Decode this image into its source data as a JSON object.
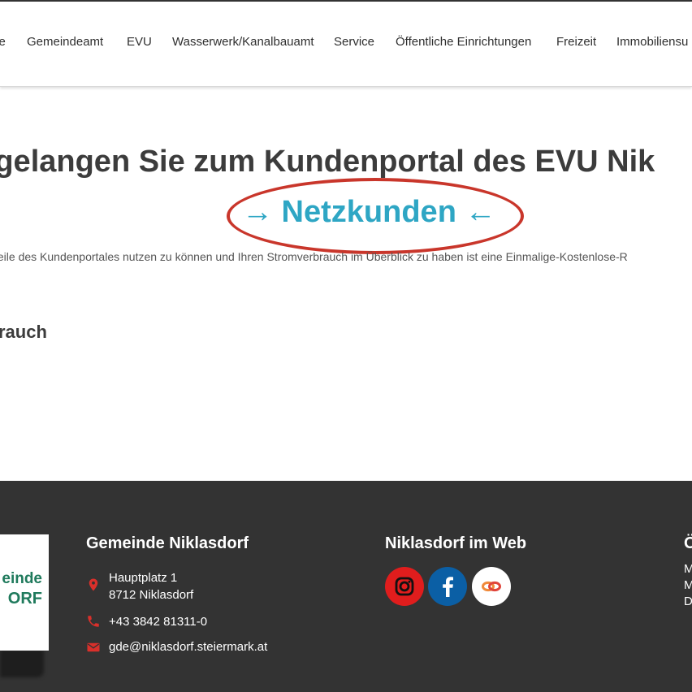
{
  "nav": {
    "items": [
      "me",
      "Gemeindeamt",
      "EVU",
      "Wasserwerk/Kanalbauamt",
      "Service",
      "Öffentliche Einrichtungen",
      "Freizeit",
      "Immobiliensu"
    ]
  },
  "main": {
    "headline": "r gelangen Sie zum Kundenportal des EVU Nik",
    "link": "→ Netzkunden ←",
    "description": "teile des Kundenportales nutzen zu können und Ihren Stromverbrauch im Überblick zu haben ist eine Einmalige-Kostenlose-R",
    "subheading": "rauch"
  },
  "footer": {
    "logo": {
      "line1": "einde",
      "line2": "ORF"
    },
    "contact": {
      "title": "Gemeinde Niklasdorf",
      "street": "Hauptplatz 1",
      "city": "8712 Niklasdorf",
      "phone": "+43 3842 81311-0",
      "email": "gde@niklasdorf.steiermark.at"
    },
    "web": {
      "title": "Niklasdorf im Web",
      "icons": [
        "instagram-icon",
        "facebook-icon",
        "linked-rings-icon"
      ]
    },
    "right": {
      "title": "Ö",
      "lines": [
        "M",
        "M",
        "D"
      ]
    }
  },
  "colors": {
    "link": "#2ea6c4",
    "highlight_ellipse": "#c9362b",
    "footer_bg": "#333333",
    "footer_icon": "#d9302b",
    "logo_text": "#1f7a5c",
    "instagram_bg": "#e01d1d",
    "facebook_bg": "#0b5fa5"
  }
}
